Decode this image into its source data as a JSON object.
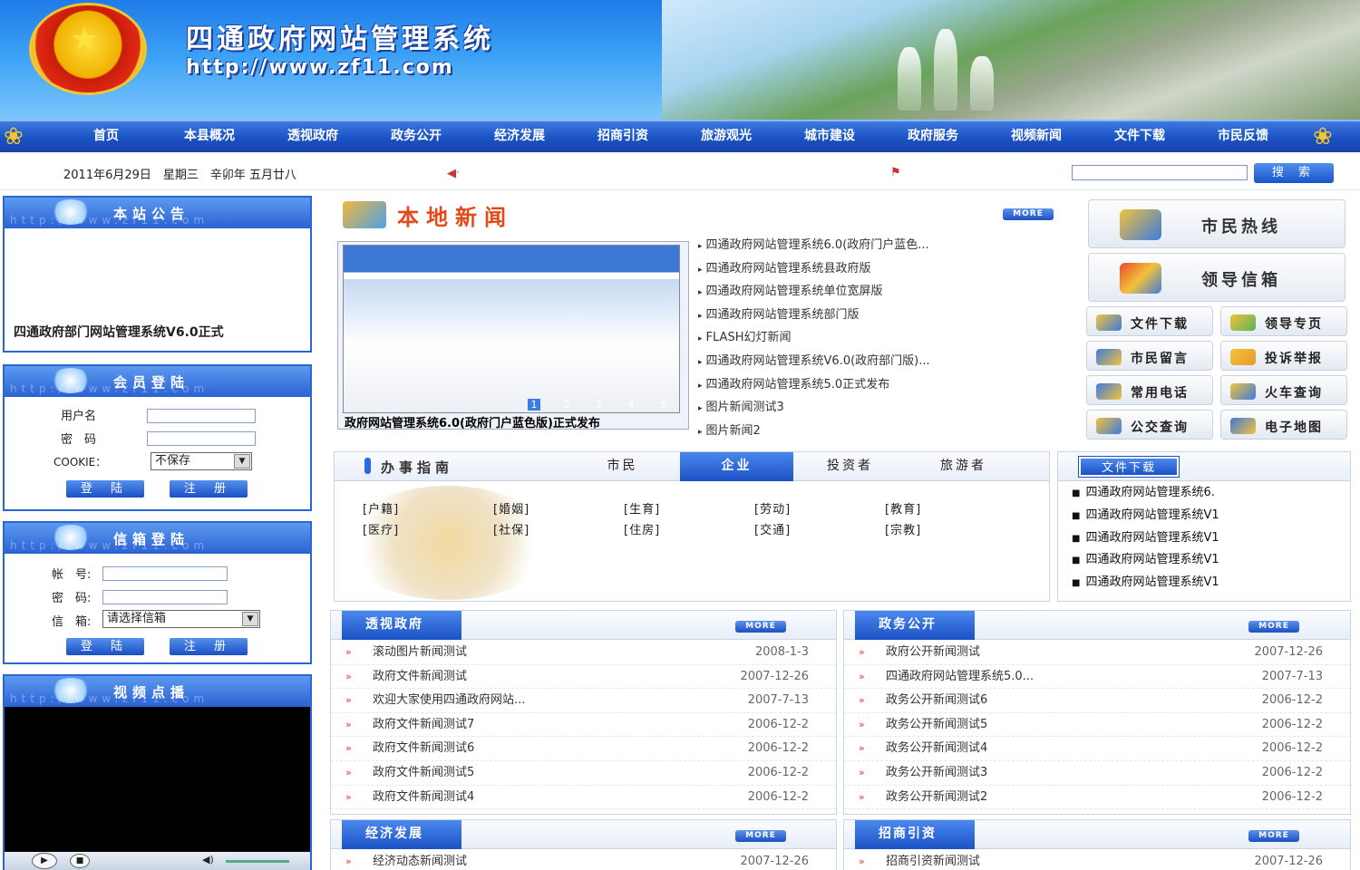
{
  "header": {
    "title": "四通政府网站管理系统",
    "url": "http://www.zf11.com"
  },
  "nav": [
    "首页",
    "本县概况",
    "透视政府",
    "政务公开",
    "经济发展",
    "招商引资",
    "旅游观光",
    "城市建设",
    "政府服务",
    "视频新闻",
    "文件下载",
    "市民反馈"
  ],
  "datebar": {
    "date": "2011年6月29日　星期三　辛卯年 五月廿八",
    "search_button": "搜 索"
  },
  "left": {
    "notice": {
      "title": "本站公告",
      "watermark": "http://www.zf11.com",
      "text": "四通政府部门网站管理系统V6.0正式"
    },
    "member": {
      "title": "会员登陆",
      "watermark": "http://www.zf11.com",
      "user_label": "用户名",
      "pass_label": "密　码",
      "cookie_label": "COOKIE：",
      "cookie_value": "不保存",
      "login": "登 陆",
      "register": "注 册"
    },
    "mail": {
      "title": "信箱登陆",
      "watermark": "http://www.zf11.com",
      "account_label": "帐　号:",
      "pass_label": "密　码:",
      "box_label": "信　箱:",
      "box_value": "请选择信箱",
      "login": "登 陆",
      "register": "注 册"
    },
    "video": {
      "title": "视频点播",
      "watermark": "http://www.zf11.com"
    }
  },
  "news": {
    "title": "本地新闻",
    "more": "MORE",
    "slide_caption": "政府网站管理系统6.0(政府门户蓝色版)正式发布",
    "slide_numbers": [
      "1",
      "2",
      "3",
      "4",
      "5"
    ],
    "items": [
      "四通政府网站管理系统6.0(政府门户蓝色...",
      "四通政府网站管理系统县政府版",
      "四通政府网站管理系统单位宽屏版",
      "四通政府网站管理系统部门版",
      "FLASH幻灯新闻",
      "四通政府网站管理系统V6.0(政府部门版)...",
      "四通政府网站管理系统5.0正式发布",
      "图片新闻测试3",
      "图片新闻2"
    ]
  },
  "right_big": [
    "市民热线",
    "领导信箱"
  ],
  "right_small": [
    "文件下载",
    "领导专页",
    "市民留言",
    "投诉举报",
    "常用电话",
    "火车查询",
    "公交查询",
    "电子地图"
  ],
  "guide": {
    "title": "办事指南",
    "tabs": [
      "市民",
      "企业",
      "投资者",
      "旅游者"
    ],
    "active_tab": "企业",
    "items": [
      "[户籍]",
      "[婚姻]",
      "[生育]",
      "[劳动]",
      "[教育]",
      "[医疗]",
      "[社保]",
      "[住房]",
      "[交通]",
      "[宗教]"
    ]
  },
  "downloads": {
    "tab": "文件下载",
    "items": [
      "四通政府网站管理系统6.",
      "四通政府网站管理系统V1",
      "四通政府网站管理系统V1",
      "四通政府网站管理系统V1",
      "四通政府网站管理系统V1"
    ]
  },
  "panels": [
    {
      "title": "透视政府",
      "more": "MORE",
      "rows": [
        [
          "滚动图片新闻测试",
          "2008-1-3"
        ],
        [
          "政府文件新闻测试",
          "2007-12-26"
        ],
        [
          "欢迎大家使用四通政府网站...",
          "2007-7-13"
        ],
        [
          "政府文件新闻测试7",
          "2006-12-2"
        ],
        [
          "政府文件新闻测试6",
          "2006-12-2"
        ],
        [
          "政府文件新闻测试5",
          "2006-12-2"
        ],
        [
          "政府文件新闻测试4",
          "2006-12-2"
        ]
      ]
    },
    {
      "title": "政务公开",
      "more": "MORE",
      "rows": [
        [
          "政府公开新闻测试",
          "2007-12-26"
        ],
        [
          "四通政府网站管理系统5.0...",
          "2007-7-13"
        ],
        [
          "政务公开新闻测试6",
          "2006-12-2"
        ],
        [
          "政务公开新闻测试5",
          "2006-12-2"
        ],
        [
          "政务公开新闻测试4",
          "2006-12-2"
        ],
        [
          "政务公开新闻测试3",
          "2006-12-2"
        ],
        [
          "政务公开新闻测试2",
          "2006-12-2"
        ]
      ]
    },
    {
      "title": "经济发展",
      "more": "MORE",
      "rows": [
        [
          "经济动态新闻测试",
          "2007-12-26"
        ]
      ]
    },
    {
      "title": "招商引资",
      "more": "MORE",
      "rows": [
        [
          "招商引资新闻测试",
          "2007-12-26"
        ]
      ]
    }
  ],
  "colors": {
    "brand_blue": "#1a52c4",
    "accent_red": "#e24a1c"
  }
}
